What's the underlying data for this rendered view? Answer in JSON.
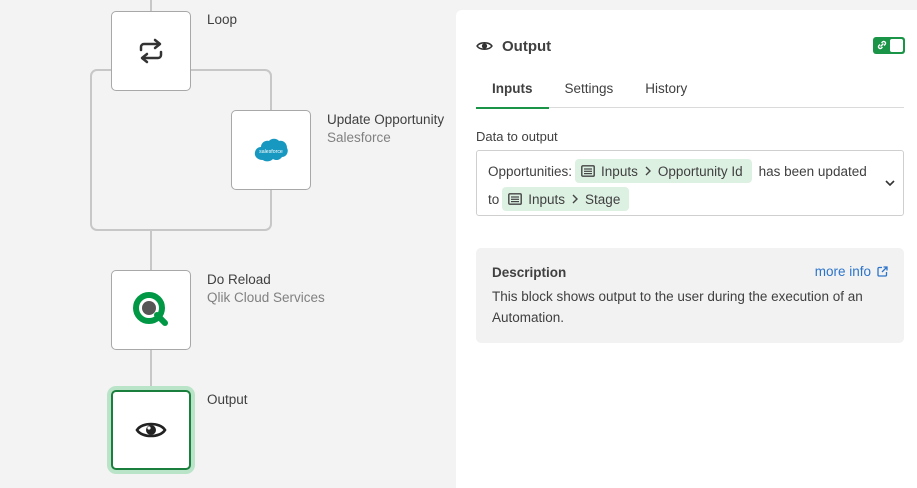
{
  "canvas": {
    "nodes": [
      {
        "id": "loop",
        "title": "Loop",
        "subtitle": "",
        "icon": "loop-icon"
      },
      {
        "id": "update-opportunity",
        "title": "Update Opportunity",
        "subtitle": "Salesforce",
        "icon": "salesforce-logo",
        "logo_text": "salesforce"
      },
      {
        "id": "do-reload",
        "title": "Do Reload",
        "subtitle": "Qlik Cloud Services",
        "icon": "qlik-logo"
      },
      {
        "id": "output",
        "title": "Output",
        "subtitle": "",
        "icon": "eye-icon"
      }
    ]
  },
  "panel": {
    "title": "Output",
    "tabs": [
      {
        "label": "Inputs",
        "active": true
      },
      {
        "label": "Settings",
        "active": false
      },
      {
        "label": "History",
        "active": false
      }
    ],
    "field": {
      "label": "Data to output",
      "row1_prefix": "Opportunities:",
      "chip1": {
        "source": "Inputs",
        "path": "Opportunity Id"
      },
      "row1_suffix": "has been updated",
      "row2_prefix": "to",
      "chip2": {
        "source": "Inputs",
        "path": "Stage"
      }
    },
    "description": {
      "title": "Description",
      "more_info": "more info",
      "text": "This block shows output to the user during the execution of an Automation."
    }
  },
  "colors": {
    "accent_green": "#1a9447",
    "chip_bg": "#ddf1e3",
    "link_blue": "#2c74c9",
    "salesforce_blue": "#1798c1",
    "qlik_green": "#009845"
  }
}
